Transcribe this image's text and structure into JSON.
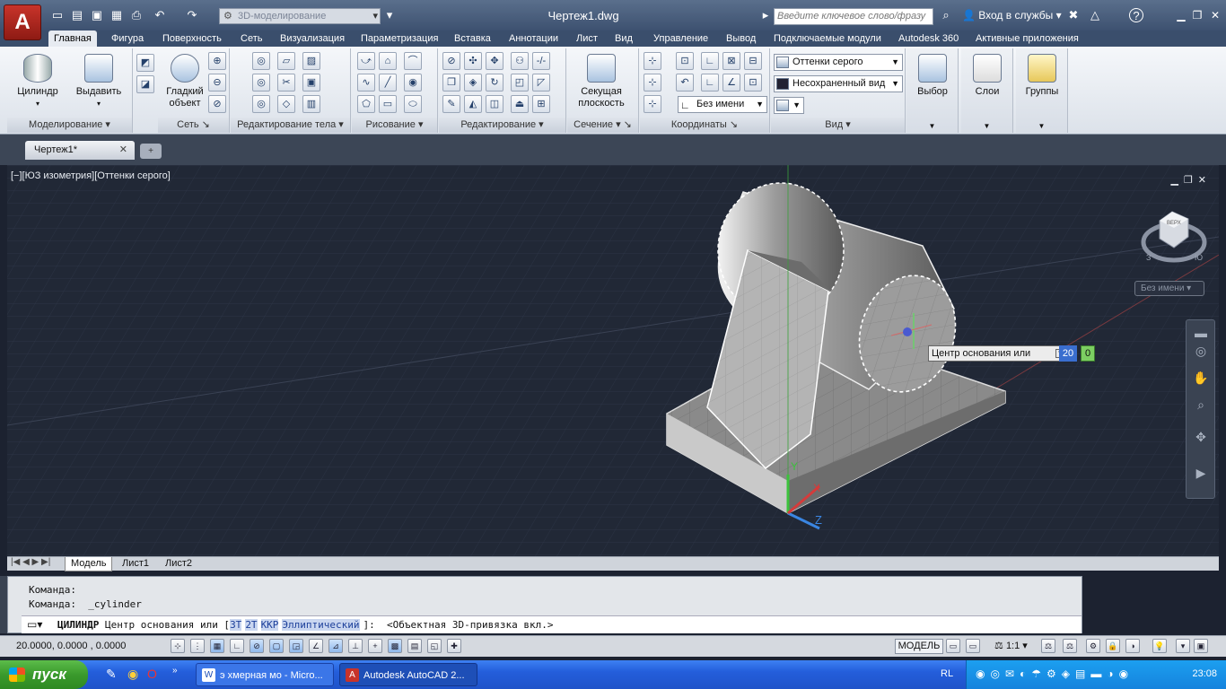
{
  "app": {
    "logo": "A",
    "document_title": "Чертеж1.dwg",
    "workspace": "3D-моделирование",
    "search_placeholder": "Введите ключевое слово/фразу",
    "signin": "Вход в службы",
    "help": "?"
  },
  "ribbon_tabs": [
    "Главная",
    "Фигура",
    "Поверхность",
    "Сеть",
    "Визуализация",
    "Параметризация",
    "Вставка",
    "Аннотации",
    "Лист",
    "Вид",
    "Управление",
    "Вывод",
    "Подключаемые модули",
    "Autodesk 360",
    "Активные приложения"
  ],
  "ribbon_tab_x": [
    54,
    118,
    175,
    262,
    306,
    396,
    500,
    561,
    636,
    679,
    722,
    803,
    856,
    995,
    1081
  ],
  "panels": {
    "modeling": {
      "title": "Моделирование",
      "cylinder": "Цилиндр",
      "extrude": "Выдавить"
    },
    "mesh": {
      "title": "Сеть",
      "smooth": "Гладкий объект"
    },
    "solid_edit": {
      "title": "Редактирование тела"
    },
    "draw": {
      "title": "Рисование"
    },
    "modify": {
      "title": "Редактирование"
    },
    "section": {
      "title": "Сечение",
      "plane": "Секущая плоскость"
    },
    "coordinates": {
      "title": "Координаты",
      "ucs_name": "Без имени"
    },
    "view": {
      "title": "Вид",
      "visual_style": "Оттенки серого",
      "saved_view": "Несохраненный вид"
    },
    "selection": {
      "label": "Выбор"
    },
    "layers": {
      "label": "Слои"
    },
    "groups": {
      "label": "Группы"
    }
  },
  "file_tab": {
    "name": "Чертеж1*",
    "close": "✕"
  },
  "viewport": {
    "label": "[−][ЮЗ изометрия][Оттенки серого]",
    "viewcube_label": "Без имени",
    "viewcube_top": "ВЕРХ",
    "compass_w": "З",
    "compass_s": "Ю",
    "ucs_x": "X",
    "ucs_y": "Y",
    "ucs_z": "Z"
  },
  "dynamic_input": {
    "prompt": "Центр основания или",
    "value1": "20",
    "value2": "0"
  },
  "layout_tabs": [
    "Модель",
    "Лист1",
    "Лист2"
  ],
  "command": {
    "history": [
      "Команда:",
      "Команда:  _cylinder"
    ],
    "prompt_cmd": "ЦИЛИНДР",
    "prompt_text": "Центр основания или [",
    "options": [
      "3T",
      "2T",
      "ККР",
      "Эллиптический"
    ],
    "prompt_tail": "]:  <Объектная 3D-привязка вкл.>"
  },
  "status": {
    "coords": "20.0000,  0.0000  , 0.0000",
    "space": "МОДЕЛЬ",
    "scale": "1:1"
  },
  "taskbar": {
    "start": "пуск",
    "items": [
      "э хмерная мо - Micro...",
      "Autodesk AutoCAD 2..."
    ],
    "lang": "RL",
    "clock": "23:08"
  },
  "colors": {
    "ribbon_active": "#e7ebf1",
    "viewport_bg": "#212836",
    "accent": "#3a6ecf"
  }
}
